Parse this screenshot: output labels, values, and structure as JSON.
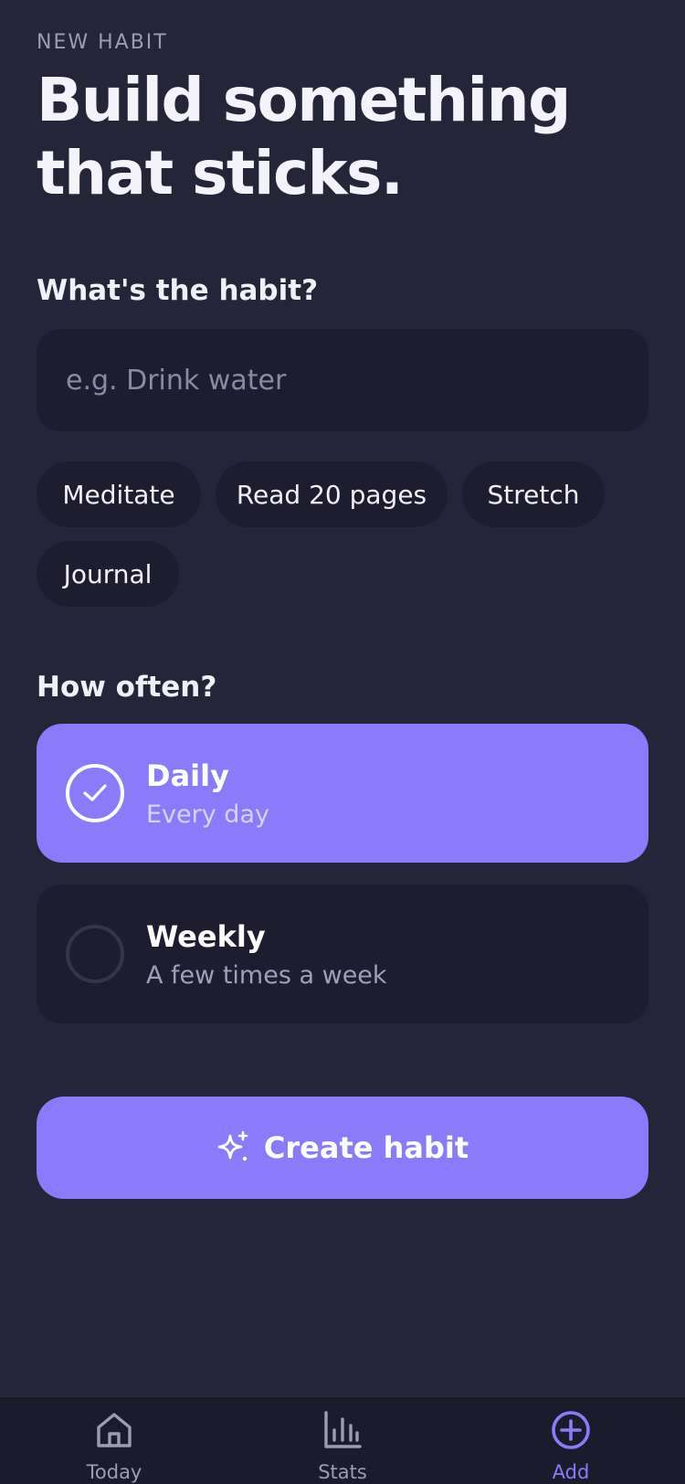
{
  "header": {
    "eyebrow": "NEW HABIT",
    "title": "Build something that sticks."
  },
  "habit": {
    "label": "What's the habit?",
    "placeholder": "e.g. Drink water",
    "value": "",
    "suggestions": [
      "Meditate",
      "Read 20 pages",
      "Stretch",
      "Journal"
    ]
  },
  "frequency": {
    "label": "How often?",
    "options": [
      {
        "title": "Daily",
        "subtitle": "Every day",
        "selected": true
      },
      {
        "title": "Weekly",
        "subtitle": "A few times a week",
        "selected": false
      }
    ]
  },
  "cta": {
    "label": "Create habit",
    "icon": "sparkle-icon"
  },
  "tabbar": {
    "tabs": [
      {
        "label": "Today",
        "icon": "home-icon",
        "active": false
      },
      {
        "label": "Stats",
        "icon": "bar-chart-icon",
        "active": false
      },
      {
        "label": "Add",
        "icon": "plus-circle-icon",
        "active": true
      }
    ]
  },
  "colors": {
    "background": "#252539",
    "surface": "#1d1d2f",
    "accent": "#8b7bfb",
    "text": "#f1f0f8",
    "muted": "#9d9cb3"
  }
}
